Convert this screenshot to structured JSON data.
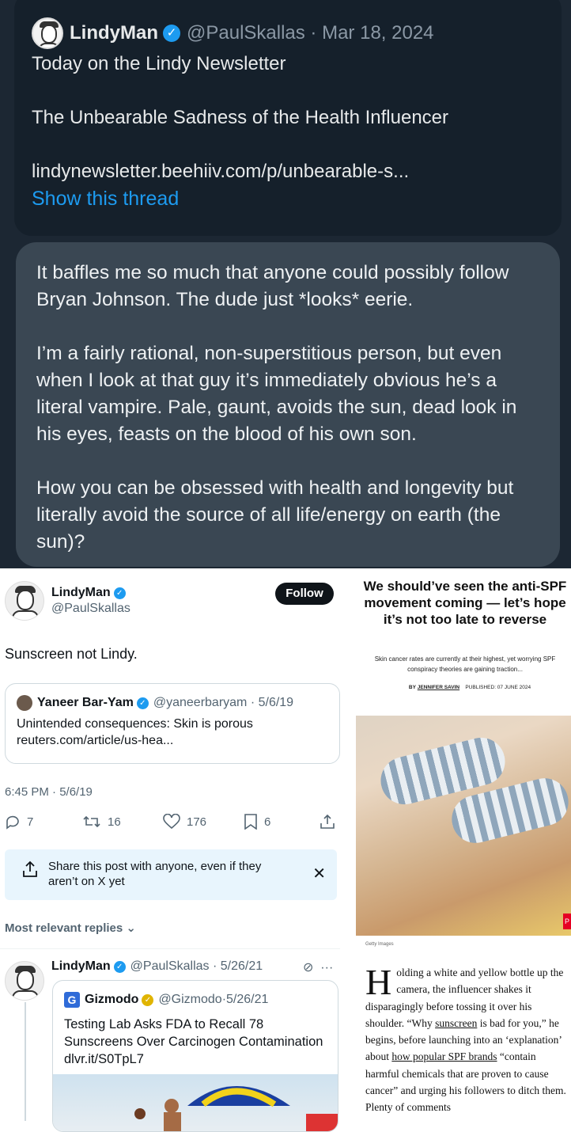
{
  "top_tweet": {
    "name": "LindyMan",
    "handle": "@PaulSkallas",
    "date": "Mar 18, 2024",
    "line1": "Today on the Lindy Newsletter",
    "line2": "The Unbearable Sadness of the Health Influencer",
    "link": "lindynewsletter.beehiiv.com/p/unbearable-s...",
    "show_thread": "Show this thread"
  },
  "reply_bubble": {
    "p1": "It baffles me so much that anyone could possibly follow Bryan Johnson. The dude just *looks* eerie.",
    "p2": "I’m a fairly rational, non-superstitious person, but even when I look at that guy it’s immediately obvious he’s a literal vampire. Pale, gaunt, avoids the sun, dead look in his eyes, feasts on the blood of his own son.",
    "p3": "How you can be obsessed with health and longevity but literally avoid the source of all life/energy on earth (the sun)?"
  },
  "tweet2": {
    "name": "LindyMan",
    "handle": "@PaulSkallas",
    "follow": "Follow",
    "text": "Sunscreen not Lindy.",
    "quote": {
      "name": "Yaneer Bar-Yam",
      "handle": "@yaneerbaryam",
      "date": "5/6/19",
      "text": "Unintended consequences: Skin is porous",
      "link": "reuters.com/article/us-hea..."
    },
    "time": "6:45 PM · 5/6/19",
    "replies": "7",
    "retweets": "16",
    "likes": "176",
    "bookmarks": "6",
    "share_prompt": "Share this post with anyone, even if they aren’t on X yet",
    "most_relevant": "Most relevant replies"
  },
  "reply": {
    "name": "LindyMan",
    "handle": "@PaulSkallas",
    "date": "5/26/21",
    "quote": {
      "name": "Gizmodo",
      "handle": "@Gizmodo",
      "date": "5/26/21",
      "text": "Testing Lab Asks FDA to Recall 78 Sunscreens Over Carcinogen Contamination dlvr.it/S0TpL7"
    }
  },
  "article": {
    "headline": "We should’ve seen the anti-SPF movement coming — let’s hope it’s not too late to reverse",
    "dek": "Skin cancer rates are currently at their highest, yet worrying SPF conspiracy theories are gaining traction...",
    "by": "BY",
    "author": "JENNIFER SAVIN",
    "published": "PUBLISHED: 07 JUNE 2024",
    "credit": "Getty Images",
    "dropcap": "H",
    "body_a": "olding a white and yellow bottle up the camera, the influencer shakes it disparagingly before tossing it over his shoulder. “Why ",
    "body_link1": "sunscreen",
    "body_b": " is bad for you,” he begins, before launching into an ‘explanation’ about ",
    "body_link2": "how popular SPF brands",
    "body_c": " “contain harmful chemicals that are proven to cause cancer” and urging his followers to ditch them. Plenty of comments",
    "pin": "P"
  },
  "colors": {
    "twitter_blue": "#1d9bf0",
    "dark_bg": "#1c2733",
    "bubble": "#3a4753"
  }
}
